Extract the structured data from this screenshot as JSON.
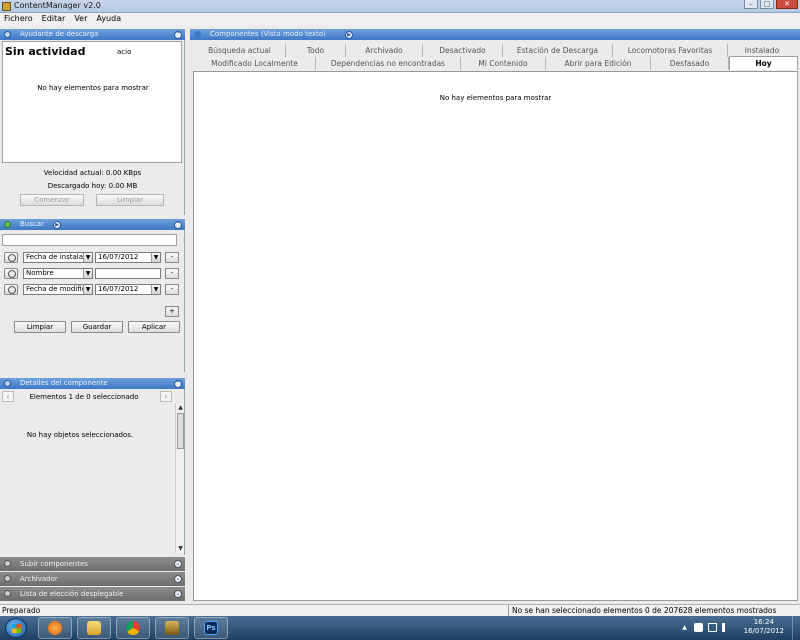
{
  "window": {
    "title": "ContentManager v2.0",
    "min": "–",
    "max": "□",
    "close": "✕"
  },
  "menu": [
    "Fichero",
    "Editar",
    "Ver",
    "Ayuda"
  ],
  "download_panel": {
    "header": "Ayudante de descarga",
    "status": "Sin actividad",
    "status_suffix": "acio",
    "empty": "No hay elementos para mostrar",
    "speed": "Velocidad actual: 0.00 KBps",
    "downloaded": "Descargado hoy: 0.00 MB",
    "start_button": "Comenzar",
    "clear_button": "Limpiar"
  },
  "search_panel": {
    "header": "Buscar",
    "search_value": "",
    "rows": [
      {
        "field": "Fecha de instalació",
        "value": "16/07/2012",
        "value_is_combo": true
      },
      {
        "field": "Nombre",
        "value": "",
        "value_is_combo": false
      },
      {
        "field": "Fecha de modificac",
        "value": "16/07/2012",
        "value_is_combo": true
      }
    ],
    "remove": "-",
    "add": "+",
    "clear_button": "Limpiar",
    "save_button": "Guardar",
    "apply_button": "Aplicar"
  },
  "details_panel": {
    "header": "Detalles del componente",
    "counter": "Elementos 1 de 0 seleccionado",
    "empty": "No hay objetos seleccionados.",
    "prev": "‹",
    "next": "›"
  },
  "bottom_panels": [
    "Subir componentes",
    "Archivador",
    "Lista de elección desplegable"
  ],
  "components": {
    "header": "Componentes (Vista modo texto)",
    "tabs_row1": [
      "Búsqueda actual",
      "Todo",
      "Archivado",
      "Desactivado",
      "Estación de Descarga",
      "Locomotoras Favoritas",
      "Instalado"
    ],
    "tabs_row2": [
      "Modificado Localmente",
      "Dependencias no encontradas",
      "Mi Contenido",
      "Abrir para Edición",
      "Desfasado",
      "Hoy"
    ],
    "active_tab": "Hoy",
    "empty": "No hay elementos para mostrar"
  },
  "statusbar": {
    "left": "Preparado",
    "right": "No se han seleccionado elementos 0 de 207628 elementos mostrados"
  },
  "taskbar": {
    "apps": [
      "media-player-icon",
      "folder-icon",
      "chrome-icon",
      "contentmanager-icon",
      "photoshop-icon"
    ],
    "photoshop_label": "Ps",
    "time": "16:24",
    "date": "16/07/2012",
    "up_arrow": "▲"
  },
  "colors": {
    "header_blue": "#3d78c5",
    "header_gray": "#6d6d6d",
    "taskbar": "#1f3f62"
  }
}
